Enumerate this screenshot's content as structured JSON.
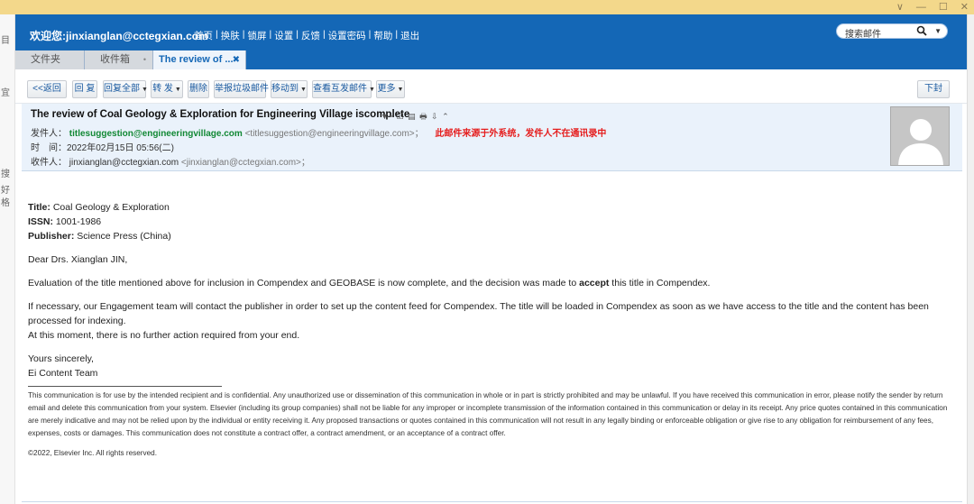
{
  "window": {
    "min_glyph": "∨",
    "restore_glyph": "—",
    "max_glyph": "☐",
    "close_glyph": "✕"
  },
  "left_strip": [
    "目",
    "宜",
    "搜",
    "好",
    "格"
  ],
  "header": {
    "welcome": "欢迎您:jinxianglan@cctegxian.com",
    "nav": [
      "首页",
      "换肤",
      "锁屏",
      "设置",
      "反馈",
      "设置密码",
      "帮助",
      "退出"
    ],
    "nav_separator": "|",
    "search_placeholder": "搜索邮件"
  },
  "tabs": [
    {
      "label": "文件夹"
    },
    {
      "label": "收件箱",
      "dot": "•"
    },
    {
      "label": "The review of ...",
      "close": "✖"
    }
  ],
  "toolbar": {
    "back": "<<返回",
    "reply": "回 复",
    "reply_all": "回复全部",
    "forward": "转 发",
    "delete": "删除",
    "report_spam": "举报垃圾邮件",
    "move_to": "移动到",
    "view_forwards": "查看互发邮件",
    "more": "更多",
    "next": "下封"
  },
  "mail": {
    "subject": "The review of Coal Geology & Exploration for Engineering Village iscomplete",
    "subject_icons": "▼• ☑ ▤ 🖶 ⇩ ⌃",
    "from_label": "发件人：",
    "from_addr": "titlesuggestion@engineeringvillage.com",
    "from_full": "<titlesuggestion@engineeringvillage.com>；",
    "external_warning": "此邮件来源于外系统，发件人不在通讯录中",
    "time_label": "时　间：",
    "time_value": "2022年02月15日 05:56(二)",
    "to_label": "收件人：",
    "to_addr": "jinxianglan@cctegxian.com",
    "to_full": "<jinxianglan@cctegxian.com>；"
  },
  "body": {
    "title_label": "Title:",
    "title_value": " Coal Geology & Exploration",
    "issn_label": "ISSN:",
    "issn_value": " 1001-1986",
    "publisher_label": "Publisher:",
    "publisher_value": " Science Press (China)",
    "greeting": "Dear Drs. Xianglan JIN,",
    "para1_pre": "Evaluation of the title mentioned above for inclusion in Compendex and GEOBASE is now complete, and the decision was made to ",
    "para1_bold": "accept",
    "para1_post": " this title in Compendex.",
    "para2_line1": "If necessary, our Engagement team will contact the publisher in order to set up the content feed for Compendex. The title will be loaded in Compendex as soon as we have access to the title and the content has been processed for indexing.",
    "para2_line2": "At this moment, there is no further action required from your end.",
    "closing": "Yours sincerely,",
    "signature": "Ei Content Team",
    "disclaimer": "This communication is for use by the intended recipient and is confidential. Any unauthorized use or dissemination of this communication in whole or in part is strictly prohibited and may be unlawful. If you have received this communication in error, please notify the sender by return email and delete this communication from your system. Elsevier (including its group companies) shall not be liable for any improper or incomplete transmission of the information contained in this communication or delay in its receipt. Any price quotes contained in this communication are merely indicative and may not be relied upon by the individual or entity receiving it. Any proposed transactions or quotes contained in this communication will not result in any legally binding or enforceable obligation or give rise to any obligation for reimbursement of any fees, expenses, costs or damages. This communication does not constitute a contract offer, a contract amendment, or an acceptance of a contract offer.",
    "copyright": "©2022, Elsevier Inc. All rights reserved."
  },
  "colors": {
    "header_blue": "#1467b6",
    "warning_red": "#e51d1d",
    "sender_green": "#118834"
  }
}
